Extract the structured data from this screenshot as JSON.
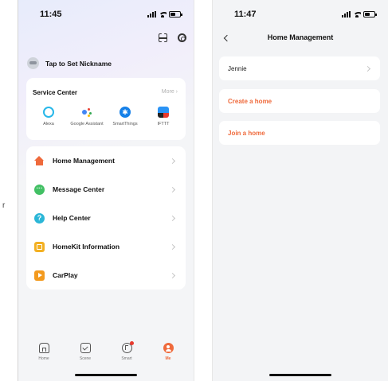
{
  "left_screen": {
    "status_time": "11:45",
    "nickname": "Tap to Set Nickname",
    "service_center": {
      "title": "Service Center",
      "more": "More",
      "items": [
        {
          "label": "Alexa",
          "icon": "alexa-icon"
        },
        {
          "label": "Google Assistant",
          "icon": "google-assistant-icon"
        },
        {
          "label": "SmartThings",
          "icon": "smartthings-icon"
        },
        {
          "label": "IFTTT",
          "icon": "ifttt-icon"
        }
      ]
    },
    "menu": [
      {
        "label": "Home Management",
        "icon": "home-icon"
      },
      {
        "label": "Message Center",
        "icon": "message-icon"
      },
      {
        "label": "Help Center",
        "icon": "help-icon"
      },
      {
        "label": "HomeKit Information",
        "icon": "homekit-icon"
      },
      {
        "label": "CarPlay",
        "icon": "carplay-icon"
      }
    ],
    "tabs": [
      {
        "label": "Home",
        "icon": "home-tab-icon",
        "active": false
      },
      {
        "label": "Scene",
        "icon": "scene-tab-icon",
        "active": false
      },
      {
        "label": "Smart",
        "icon": "smart-tab-icon",
        "active": false
      },
      {
        "label": "Me",
        "icon": "me-tab-icon",
        "active": true
      }
    ]
  },
  "right_screen": {
    "status_time": "11:47",
    "title": "Home Management",
    "home_name": "Jennie",
    "create_label": "Create a home",
    "join_label": "Join a home"
  },
  "stray_text": "r",
  "colors": {
    "accent": "#ef6a3c",
    "background": "#f3f4f6",
    "card": "#ffffff"
  }
}
